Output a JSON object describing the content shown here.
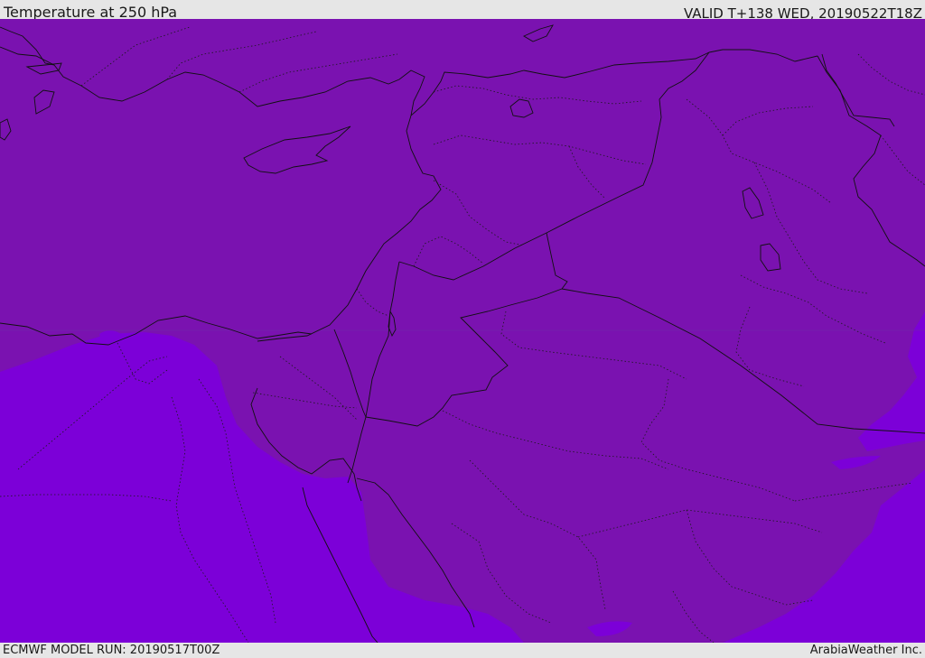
{
  "header": {
    "title": "Temperature at 250 hPa",
    "valid": "VALID T+138 WED, 20190522T18Z"
  },
  "footer": {
    "model_run": "ECMWF MODEL RUN: 20190517T00Z",
    "credit": "ArabiaWeather Inc."
  },
  "map": {
    "colors": {
      "band_cold": "#7a12b0",
      "band_warm": "#7c00d8",
      "lines": "#111111",
      "frame": "#e6e6e6"
    }
  }
}
